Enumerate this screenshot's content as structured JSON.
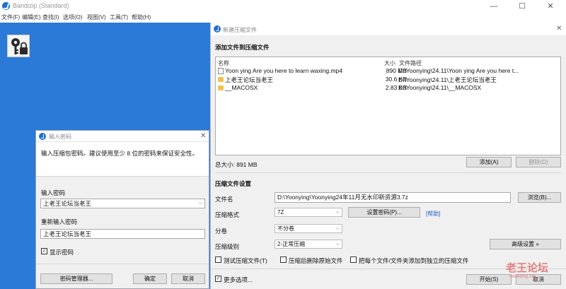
{
  "app": {
    "title": "Bandizip (Standard)",
    "window_controls": [
      "—",
      "☐",
      "✕"
    ]
  },
  "menu": [
    "文件(F)",
    "编辑(E)",
    "查找(I)",
    "选项(O)",
    "视图(V)",
    "工具(T)",
    "帮助(H)"
  ],
  "password_dialog": {
    "title": "输入密码",
    "close": "✕",
    "instruction": "输入压缩包密码。建议使用至少 8 位的密码来保证安全性。",
    "password_label": "输入密码",
    "password_value": "上老王论坛当老王",
    "reenter_label": "重新输入密码",
    "reenter_value": "上老王论坛当老王",
    "show_password_label": "显示密码",
    "show_password_checked": true,
    "manager_button": "密码管理器...",
    "ok_button": "确定",
    "cancel_button": "取消"
  },
  "archive_window": {
    "title": "新建压缩文件",
    "close": "✕",
    "add_files_heading": "添加文件到压缩文件",
    "columns": {
      "name": "名称",
      "size": "大小",
      "path": "文件路径"
    },
    "files": [
      {
        "icon": "video-file-icon",
        "name": "Yoon ying Are you here to learn waxing.mp4",
        "size": "890 MB",
        "path": "D:\\Yoonying\\24.11\\Yoon ying Are you here t..."
      },
      {
        "icon": "folder-icon",
        "name": "上老王论坛当老王",
        "size": "30.6 KB",
        "path": "D:\\Yoonying\\24.11\\上老王论坛当老王"
      },
      {
        "icon": "folder-icon",
        "name": "__MACOSX",
        "size": "2.83 KB",
        "path": "D:\\Yoonying\\24.11\\__MACOSX"
      }
    ],
    "total_size": "总大小: 891 MB",
    "add_button": "添加(A)",
    "remove_button": "删除(D)",
    "settings_heading": "压缩文件设置",
    "filename_label": "文件名",
    "filename_value": "D:\\Yoonying\\Yoonying24年11月无水印新资源3.7z",
    "browse_button": "浏览(B)...",
    "format_label": "压缩格式",
    "format_value": "7Z",
    "set_password_button": "设置密码(P)...",
    "help_link": "[帮助]",
    "split_label": "分卷",
    "split_value": "不分卷",
    "level_label": "压缩级别",
    "level_value": "2-正常压缩",
    "advanced_button": "高级设置 »",
    "test_label": "测试压缩文件(T)",
    "delete_after_label": "压缩后删除原始文件",
    "each_separate_label": "把每个文件/文件夹添加到独立的压缩文件",
    "more_options_label": "更多选项...",
    "more_options_checked": true,
    "start_button": "开始(S)",
    "cancel_button": "取消"
  },
  "watermark": {
    "main": "老王论坛",
    "sub": "laowang.vip"
  }
}
